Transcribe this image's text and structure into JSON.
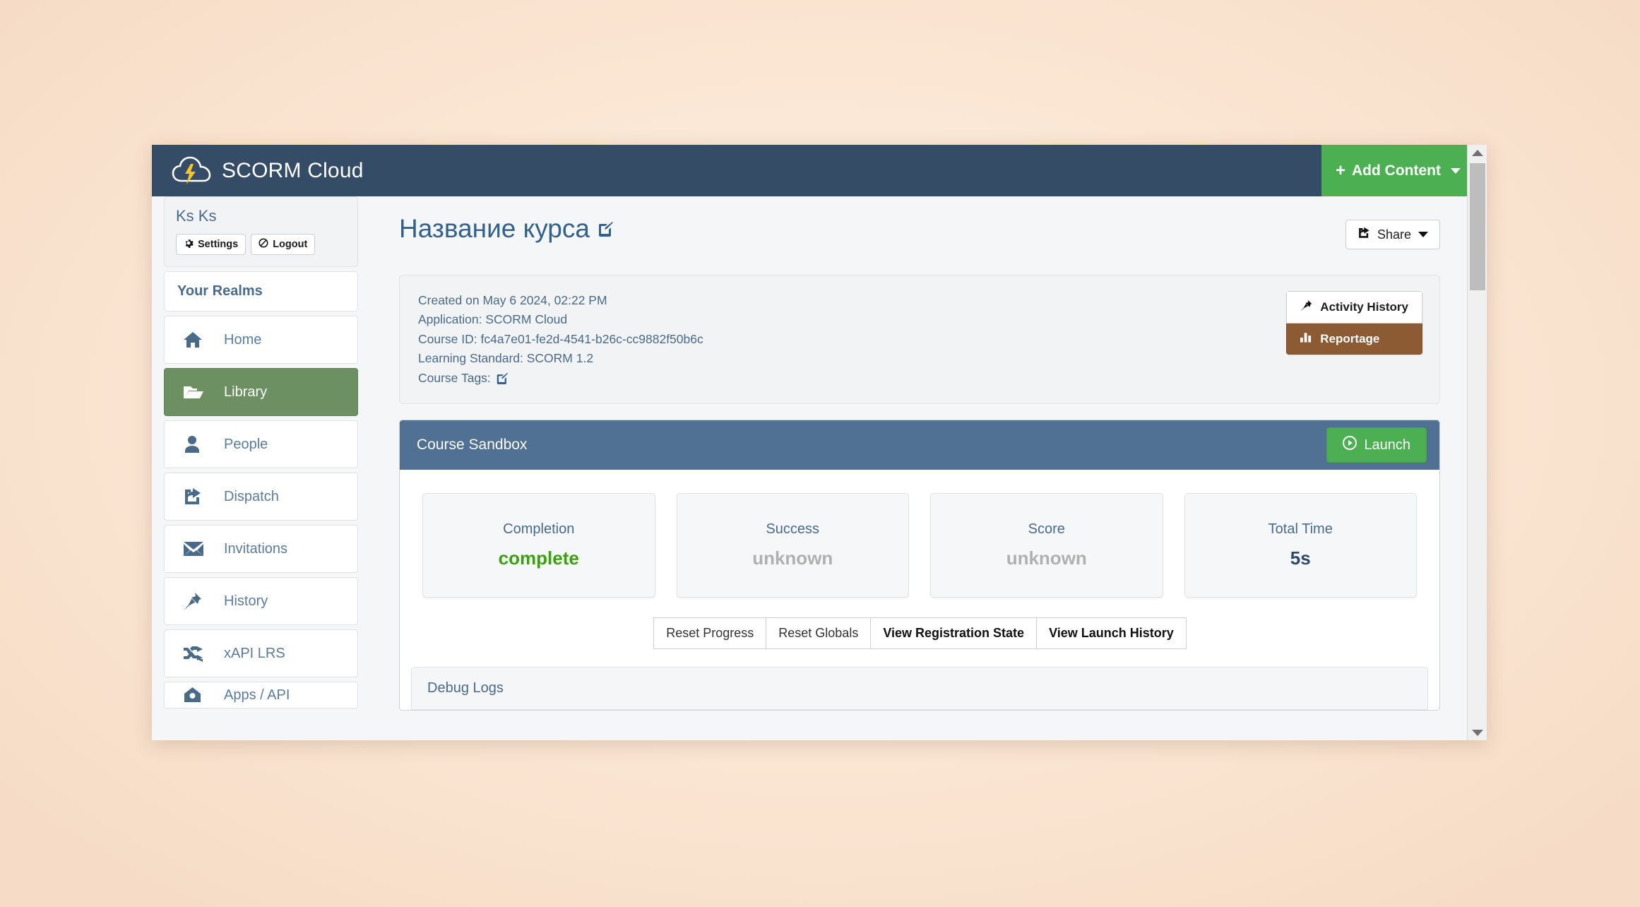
{
  "navbar": {
    "brand": "SCORM Cloud",
    "add_content_label": "Add Content",
    "add_content_plus": "+",
    "brand_accent": "#f7c425",
    "bg": "#344c66"
  },
  "sidebar": {
    "user_name": "Ks Ks",
    "settings_label": "Settings",
    "logout_label": "Logout",
    "realms_header": "Your Realms",
    "items": [
      {
        "label": "Home",
        "icon": "home-icon",
        "active": false
      },
      {
        "label": "Library",
        "icon": "folder-icon",
        "active": true
      },
      {
        "label": "People",
        "icon": "person-icon",
        "active": false
      },
      {
        "label": "Dispatch",
        "icon": "dispatch-share-icon",
        "active": false
      },
      {
        "label": "Invitations",
        "icon": "envelope-icon",
        "active": false
      },
      {
        "label": "History",
        "icon": "pin-icon",
        "active": false
      },
      {
        "label": "xAPI LRS",
        "icon": "shuffle-icon",
        "active": false
      },
      {
        "label": "Apps / API",
        "icon": "apps-icon",
        "active": false
      }
    ],
    "active_bg": "#6d9063"
  },
  "main": {
    "page_title": "Название курса",
    "share_label": "Share",
    "info": {
      "created": "Created on May 6 2024, 02:22 PM",
      "application": "Application: SCORM Cloud",
      "course_id": "Course ID: fc4a7e01-fe2d-4541-b26c-cc9882f50b6c",
      "learning_standard": "Learning Standard: SCORM 1.2",
      "course_tags": "Course Tags:"
    },
    "actions": {
      "activity_history": "Activity History",
      "reportage": "Reportage",
      "reportage_bg": "#8c5a33"
    },
    "sandbox": {
      "title": "Course Sandbox",
      "launch_label": "Launch",
      "launch_bg": "#4caf52",
      "header_bg": "#507094",
      "cards": [
        {
          "label": "Completion",
          "value": "complete",
          "state": "complete"
        },
        {
          "label": "Success",
          "value": "unknown",
          "state": "unknown"
        },
        {
          "label": "Score",
          "value": "unknown",
          "state": "unknown"
        },
        {
          "label": "Total Time",
          "value": "5s",
          "state": "value"
        }
      ],
      "buttons": [
        {
          "label": "Reset Progress",
          "bold": false
        },
        {
          "label": "Reset Globals",
          "bold": false
        },
        {
          "label": "View Registration State",
          "bold": true
        },
        {
          "label": "View Launch History",
          "bold": true
        }
      ]
    },
    "debug_logs_title": "Debug Logs"
  }
}
